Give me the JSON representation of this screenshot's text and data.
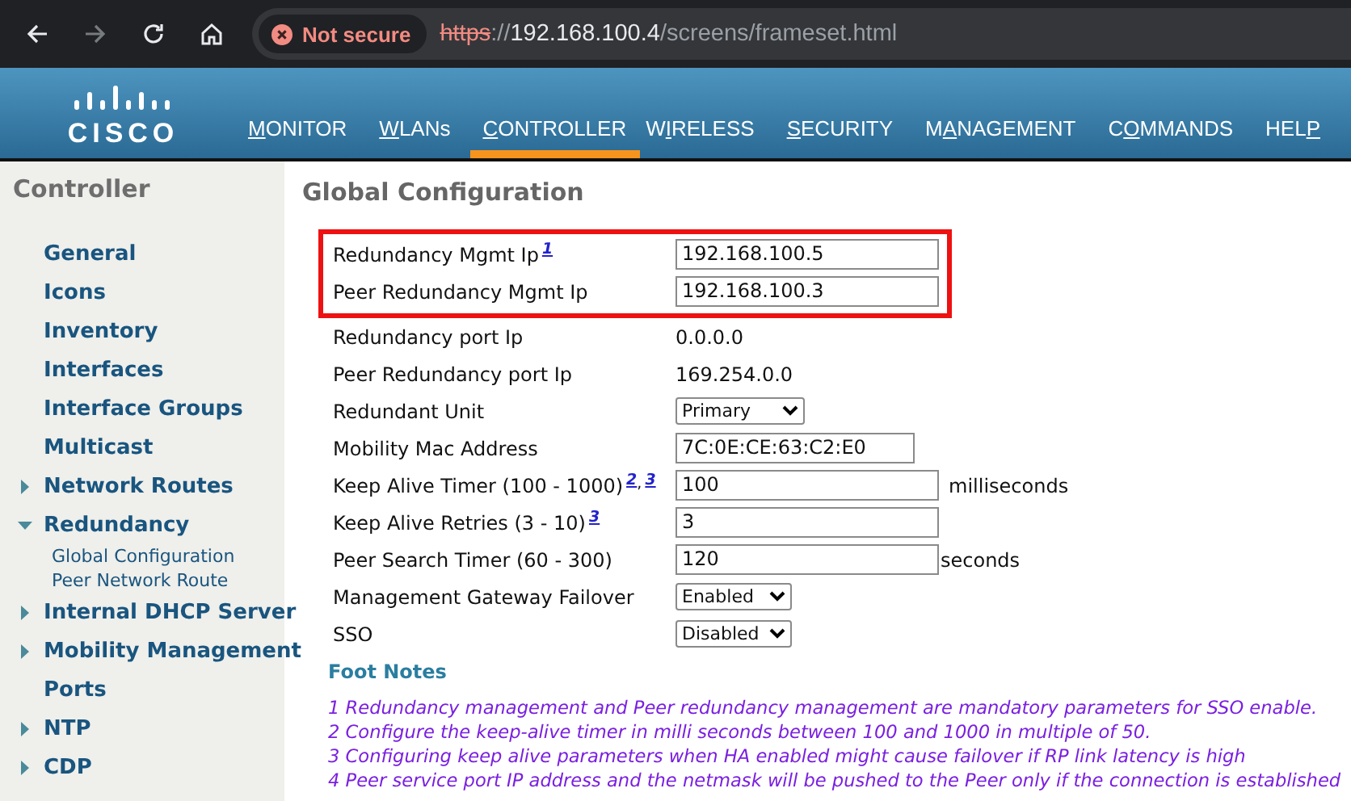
{
  "browser": {
    "back_disabled": false,
    "forward_disabled": true,
    "security": "Not secure",
    "address": {
      "scheme": "https",
      "separator": "://",
      "host": "192.168.100.4",
      "path": "/screens/frameset.html"
    }
  },
  "header": {
    "logo_text": "CISCO",
    "nav": [
      {
        "key": "M",
        "post": "ONITOR",
        "selected": false
      },
      {
        "key": "W",
        "post": "LANs",
        "selected": false
      },
      {
        "key": "C",
        "post": "ONTROLLER",
        "selected": true
      },
      {
        "pre": "W",
        "key": "I",
        "post": "RELESS",
        "selected": false
      },
      {
        "key": "S",
        "post": "ECURITY",
        "selected": false
      },
      {
        "pre": "M",
        "key": "A",
        "post": "NAGEMENT",
        "selected": false
      },
      {
        "pre": "C",
        "key": "O",
        "post": "MMANDS",
        "selected": false
      },
      {
        "pre": "HEL",
        "key": "P",
        "selected": false
      }
    ]
  },
  "sidebar": {
    "title": "Controller",
    "items": [
      {
        "kind": "link",
        "label": "General"
      },
      {
        "kind": "link",
        "label": "Icons"
      },
      {
        "kind": "link",
        "label": "Inventory"
      },
      {
        "kind": "link",
        "label": "Interfaces"
      },
      {
        "kind": "link",
        "label": "Interface Groups"
      },
      {
        "kind": "link",
        "label": "Multicast"
      },
      {
        "kind": "folder",
        "label": "Network Routes",
        "expanded": false
      },
      {
        "kind": "folder",
        "label": "Redundancy",
        "expanded": true,
        "children": [
          {
            "label": "Global Configuration"
          },
          {
            "label": "Peer Network Route"
          }
        ]
      },
      {
        "kind": "folder",
        "label": "Internal DHCP Server",
        "expanded": false
      },
      {
        "kind": "folder",
        "label": "Mobility Management",
        "expanded": false
      },
      {
        "kind": "link",
        "label": "Ports"
      },
      {
        "kind": "folder",
        "label": "NTP",
        "expanded": false
      },
      {
        "kind": "folder",
        "label": "CDP",
        "expanded": false
      }
    ]
  },
  "page": {
    "title": "Global Configuration",
    "groups": [
      {
        "highlighted": true,
        "rows": [
          {
            "label": "Redundancy Mgmt Ip",
            "refs": [
              "1"
            ],
            "kind": "input",
            "value": "192.168.100.5"
          },
          {
            "label": "Peer Redundancy Mgmt Ip",
            "kind": "input",
            "value": "192.168.100.3"
          }
        ]
      },
      {
        "highlighted": false,
        "rows": [
          {
            "label": "Redundancy port Ip",
            "kind": "text",
            "value": "0.0.0.0"
          },
          {
            "label": "Peer Redundancy port Ip",
            "kind": "text",
            "value": "169.254.0.0"
          },
          {
            "label": "Redundant Unit",
            "kind": "select",
            "value": "Primary"
          },
          {
            "label": "Mobility Mac Address",
            "kind": "input_short",
            "value": "7C:0E:CE:63:C2:E0"
          },
          {
            "label": "Keep Alive Timer (100 - 1000)",
            "refs": [
              "2",
              "3"
            ],
            "ref_separator": ",",
            "kind": "input",
            "value": "100",
            "suffix": "milliseconds"
          },
          {
            "label": "Keep Alive Retries (3 - 10)",
            "refs": [
              "3"
            ],
            "kind": "input",
            "value": "3"
          },
          {
            "label": "Peer Search Timer (60 - 300)",
            "kind": "input",
            "value": "120",
            "suffix": "seconds",
            "suffix_attached": true
          },
          {
            "label": "Management Gateway Failover",
            "kind": "select_small",
            "value": "Enabled"
          },
          {
            "label": "SSO",
            "kind": "select_small",
            "value": "Disabled"
          }
        ]
      }
    ],
    "footnotes_title": "Foot Notes",
    "footnotes": [
      "1 Redundancy management and Peer redundancy management are mandatory parameters for SSO enable.",
      "2 Configure the keep-alive timer in milli seconds between 100 and 1000 in multiple of 50.",
      "3 Configuring keep alive parameters when HA enabled might cause failover if RP link latency is high",
      "4 Peer service port IP address and the netmask will be pushed to the Peer only if the connection is established"
    ]
  }
}
